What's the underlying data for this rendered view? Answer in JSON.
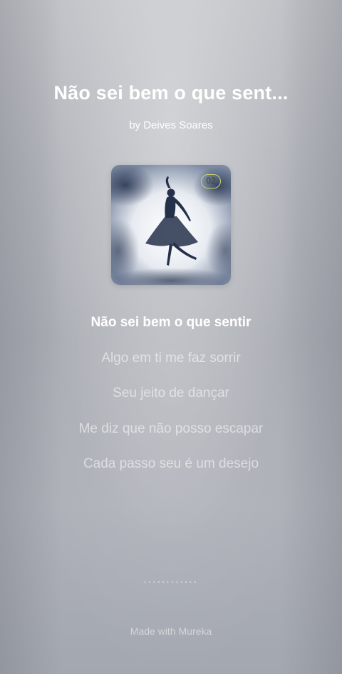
{
  "song": {
    "title": "Não sei bem o que sent...",
    "artist": "by Deives Soares",
    "track_badge": "02"
  },
  "lyrics": [
    "Não sei bem o que sentir",
    "Algo em ti me faz sorrir",
    "Seu jeito de dançar",
    "Me diz que não posso escapar",
    "Cada passo seu é um desejo"
  ],
  "progress_dots": "............",
  "footer": {
    "credit": "Made with Mureka"
  },
  "colors": {
    "background": "#b2b5bb",
    "active_lyric": "#ffffff",
    "badge_border": "#c8d66b"
  }
}
